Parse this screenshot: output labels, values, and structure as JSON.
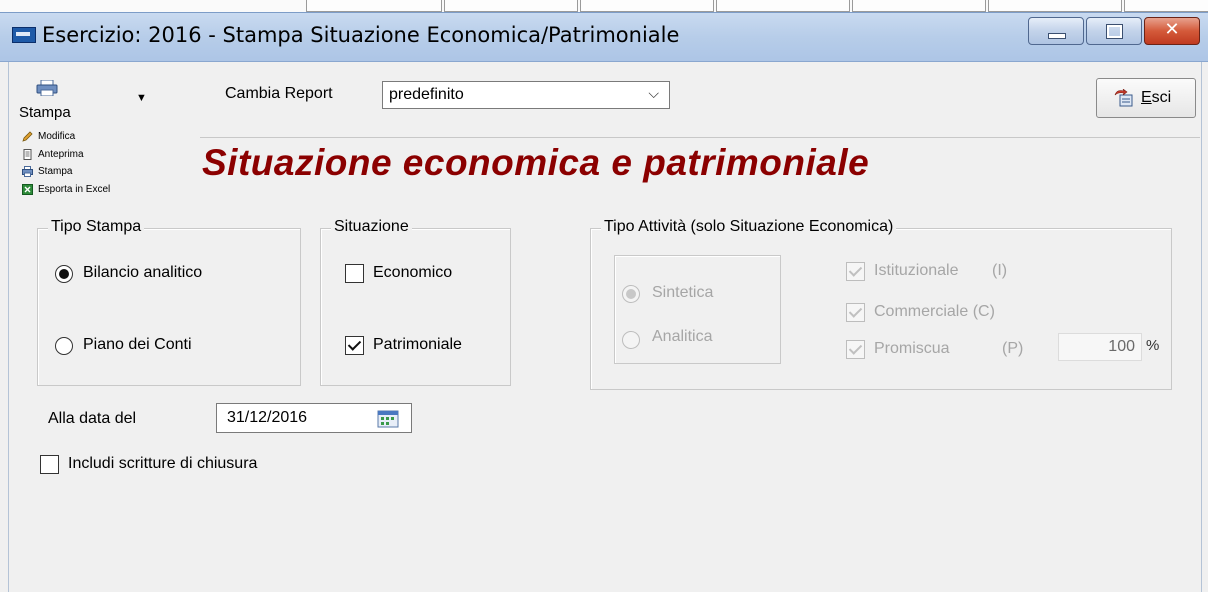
{
  "window": {
    "title": "Esercizio: 2016 - Stampa Situazione Economica/Patrimoniale",
    "close_glyph": "✕"
  },
  "toolbar": {
    "stampa_label": "Stampa",
    "stampa_menu": [
      "Modifica",
      "Anteprima",
      "Stampa",
      "Esporta in Excel"
    ],
    "cambia_report_label": "Cambia Report",
    "report_value": "predefinito",
    "report_chevron": "⌵",
    "esci_label_prefix": "E",
    "esci_label_rest": "sci"
  },
  "headline": "Situazione economica e patrimoniale",
  "tipo_stampa": {
    "title": "Tipo Stampa",
    "options": [
      {
        "label": "Bilancio analitico",
        "selected": true
      },
      {
        "label": "Piano dei Conti",
        "selected": false
      }
    ]
  },
  "situazione": {
    "title": "Situazione",
    "options": [
      {
        "label": "Economico",
        "checked": false
      },
      {
        "label": "Patrimoniale",
        "checked": true
      }
    ]
  },
  "tipo_attivita": {
    "title": "Tipo Attività (solo Situazione Economica)",
    "radio": [
      {
        "label": "Sintetica",
        "selected": true
      },
      {
        "label": "Analitica",
        "selected": false
      }
    ],
    "checks": [
      {
        "label": "Istituzionale",
        "code": "(I)",
        "checked": true
      },
      {
        "label": "Commerciale (C)",
        "checked": true
      },
      {
        "label": "Promiscua",
        "code": "(P)",
        "checked": true
      }
    ],
    "percent_value": "100",
    "percent_sign": "%"
  },
  "date": {
    "label": "Alla data del",
    "value": "31/12/2016"
  },
  "include_closing": {
    "label": "Includi scritture di chiusura",
    "checked": false
  }
}
